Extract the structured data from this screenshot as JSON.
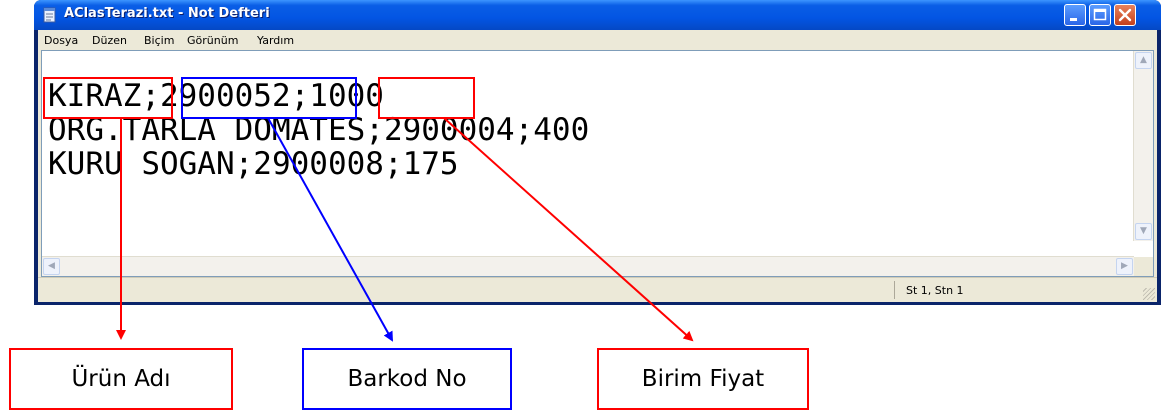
{
  "window": {
    "title": "AClasTerazi.txt - Not Defteri"
  },
  "menubar": {
    "items": [
      "Dosya",
      "Düzen",
      "Biçim",
      "Görünüm",
      "Yardım"
    ]
  },
  "editor": {
    "lines": [
      "KIRAZ;2900052;1000",
      "ORG.TARLA DOMATES;2900004;400",
      "KURU SOGAN;2900008;175"
    ]
  },
  "statusbar": {
    "position": "St 1, Stn 1"
  },
  "annotations": {
    "labels": [
      "Ürün Adı",
      "Barkod No",
      "Birim Fiyat"
    ],
    "colors": {
      "product_name": "#ff0000",
      "barcode": "#0000ff",
      "unit_price": "#ff0000"
    }
  },
  "icons": [
    "notepad-icon",
    "minimize-icon",
    "maximize-icon",
    "close-icon",
    "scroll-up-icon",
    "scroll-down-icon",
    "scroll-left-icon",
    "scroll-right-icon",
    "resize-grip-icon"
  ]
}
